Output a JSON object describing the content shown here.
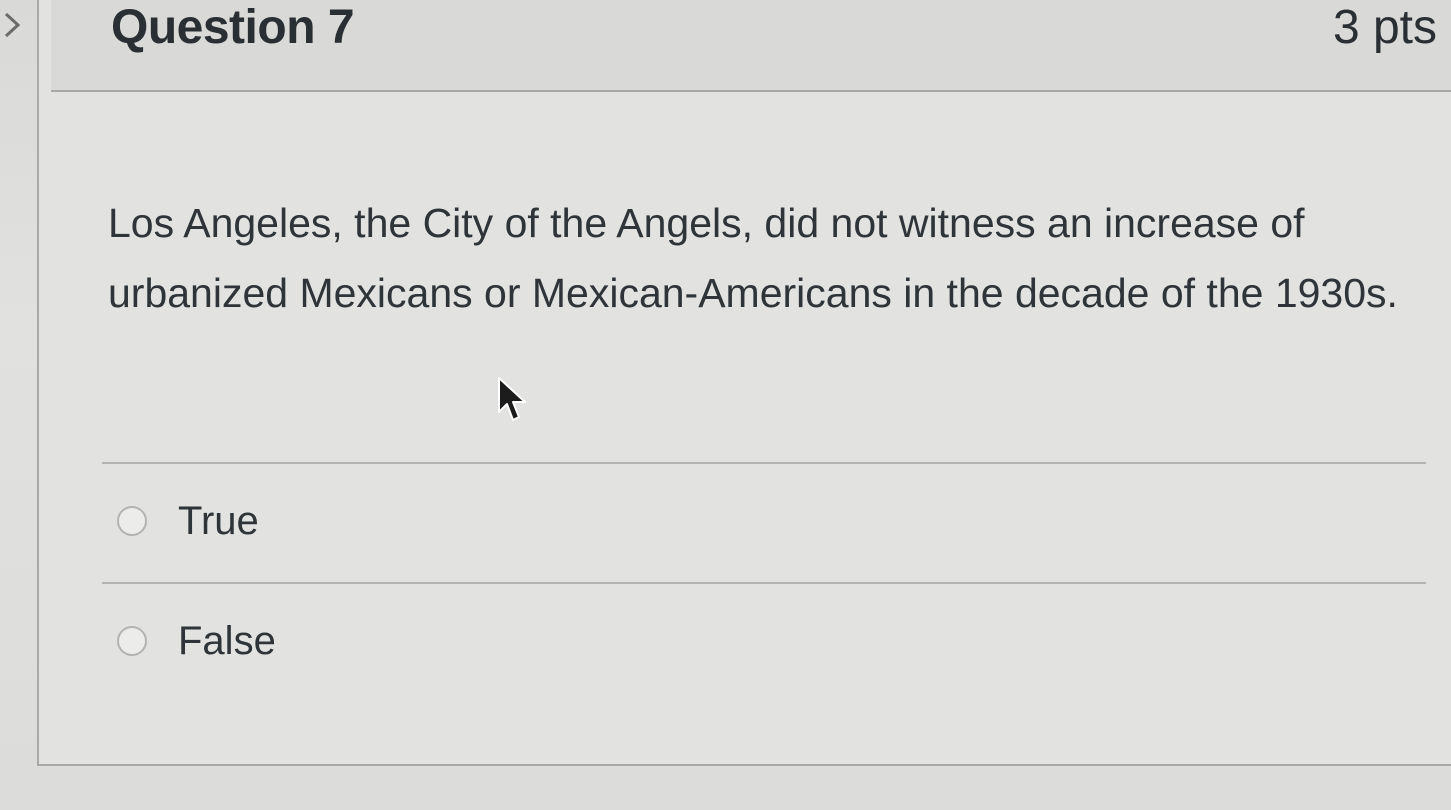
{
  "question": {
    "title": "Question 7",
    "points": "3 pts",
    "text": "Los Angeles, the City of the Angels, did not witness an increase of urbanized Mexicans or Mexican-Americans in the decade of the 1930s."
  },
  "answers": [
    {
      "label": "True",
      "selected": false
    },
    {
      "label": "False",
      "selected": false
    }
  ],
  "icons": {
    "collapse": "chevron-right-icon",
    "cursor": "mouse-pointer-icon",
    "radio": "radio-unselected-icon"
  },
  "colors": {
    "text": "#2e3438",
    "border": "#a9a9a7",
    "header_bg": "#d9d9d7"
  }
}
